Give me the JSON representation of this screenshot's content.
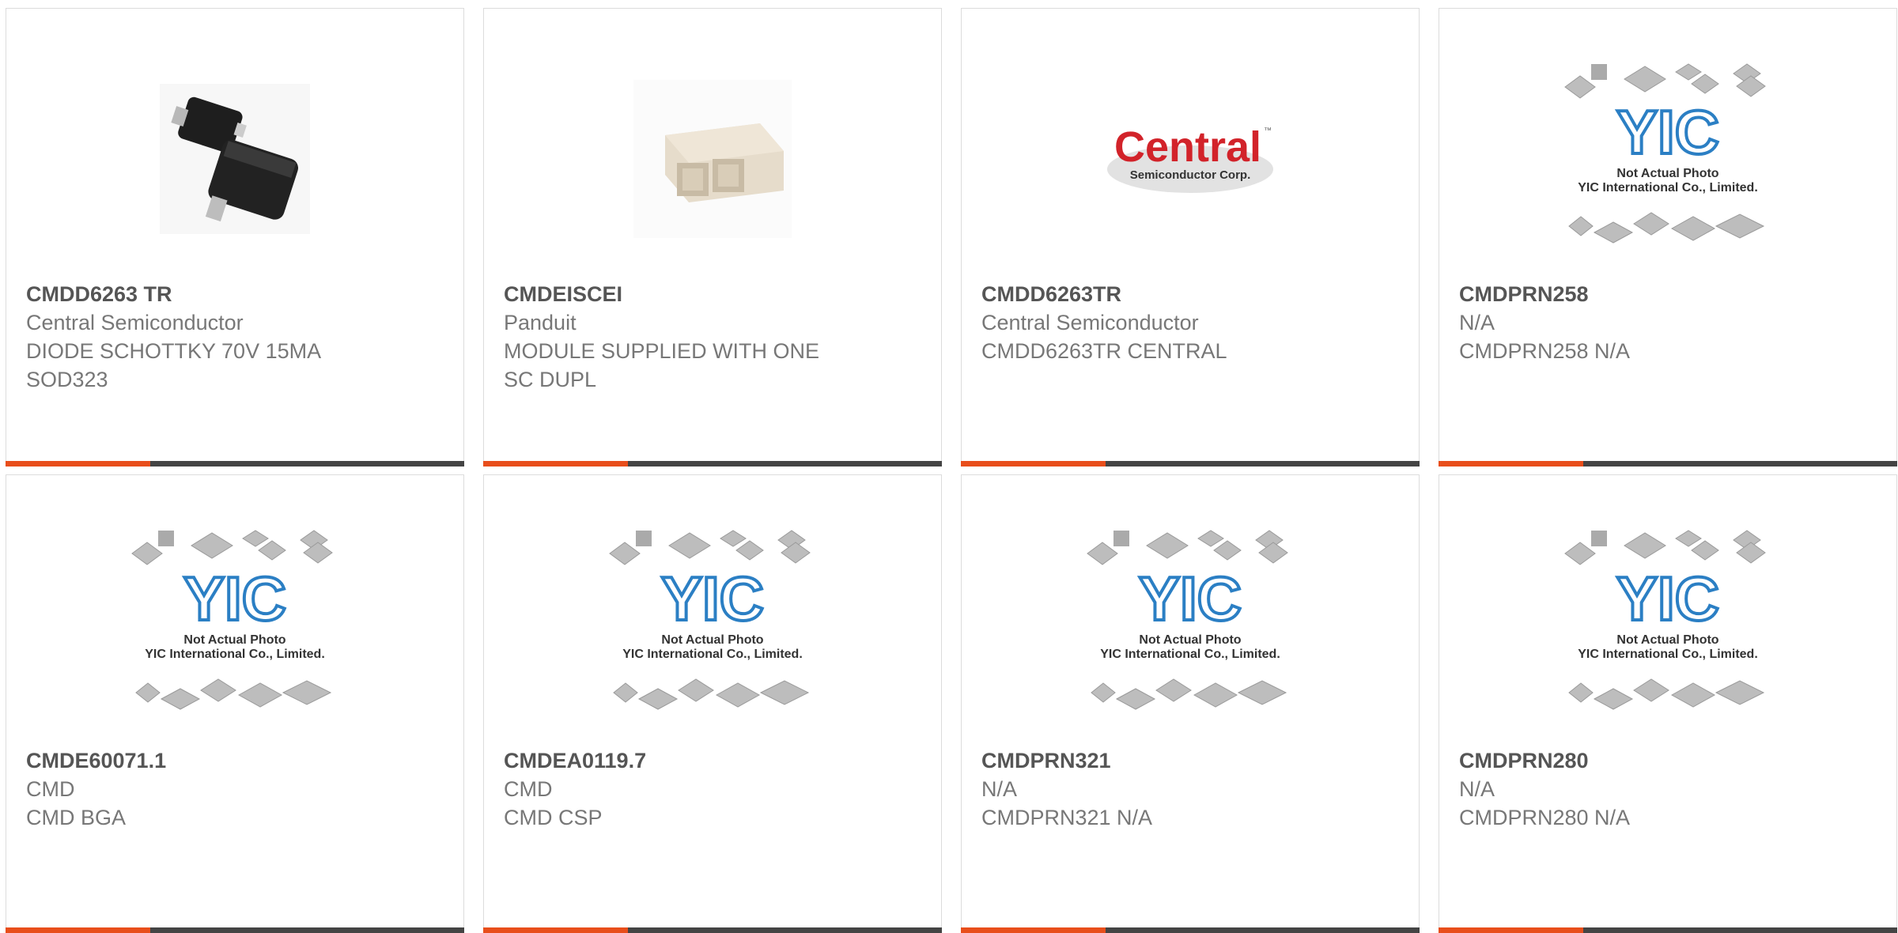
{
  "products": [
    {
      "part": "CMDD6263 TR",
      "manufacturer": "Central Semiconductor",
      "description": "DIODE SCHOTTKY 70V 15MA SOD323",
      "image": "diode-sod323-photo"
    },
    {
      "part": "CMDEISCEI",
      "manufacturer": "Panduit",
      "description": "MODULE SUPPLIED WITH ONE SC DUPL",
      "image": "sc-duplex-adapter-photo"
    },
    {
      "part": "CMDD6263TR",
      "manufacturer": "Central Semiconductor",
      "description": "CMDD6263TR CENTRAL",
      "image": "central-semiconductor-logo"
    },
    {
      "part": "CMDPRN258",
      "manufacturer": "N/A",
      "description": "CMDPRN258 N/A",
      "image": "yic-placeholder"
    },
    {
      "part": "CMDE60071.1",
      "manufacturer": "CMD",
      "description": "CMD BGA",
      "image": "yic-placeholder"
    },
    {
      "part": "CMDEA0119.7",
      "manufacturer": "CMD",
      "description": "CMD CSP",
      "image": "yic-placeholder"
    },
    {
      "part": "CMDPRN321",
      "manufacturer": "N/A",
      "description": "CMDPRN321 N/A",
      "image": "yic-placeholder"
    },
    {
      "part": "CMDPRN280",
      "manufacturer": "N/A",
      "description": "CMDPRN280 N/A",
      "image": "yic-placeholder"
    }
  ],
  "placeholder": {
    "line1": "Not Actual Photo",
    "line2": "YIC International Co., Limited.",
    "logo_text": "YIC"
  },
  "central_logo": {
    "name": "Central",
    "tm": "™",
    "sub": "Semiconductor Corp."
  },
  "colors": {
    "accent": "#e84e1b",
    "bar": "#444444",
    "text_dark": "#555555",
    "text_light": "#777777",
    "yic_blue": "#2b7fc4",
    "central_red": "#d2232a"
  }
}
